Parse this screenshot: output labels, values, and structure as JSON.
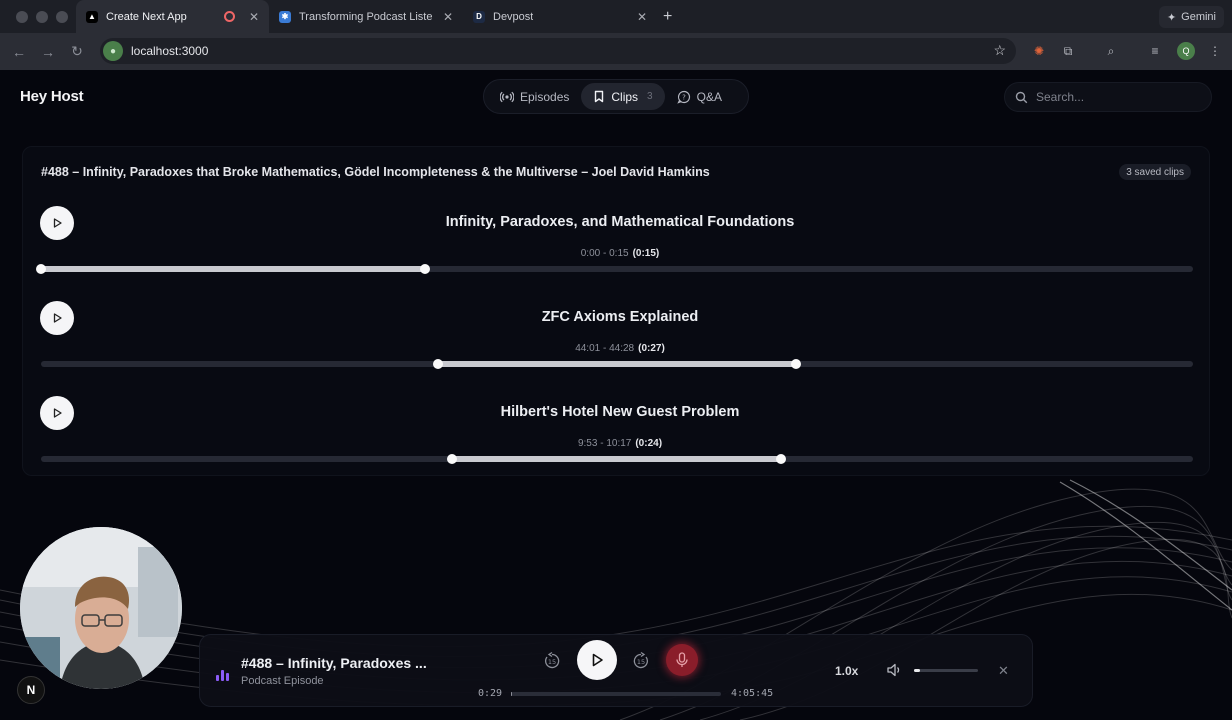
{
  "browser": {
    "tabs": [
      {
        "title": "Create Next App",
        "active": true,
        "recording": true
      },
      {
        "title": "Transforming Podcast Listeni",
        "active": false
      },
      {
        "title": "Devpost",
        "active": false
      }
    ],
    "new_tab_icon": "plus-icon",
    "gemini_label": "Gemini",
    "url": "localhost:3000",
    "profile_initial": "Q"
  },
  "app": {
    "logo": "Hey Host",
    "nav": {
      "episodes_label": "Episodes",
      "clips_label": "Clips",
      "clips_count": "3",
      "qa_label": "Q&A",
      "active": "clips"
    },
    "search": {
      "placeholder": "Search..."
    },
    "episode": {
      "title": "#488 – Infinity, Paradoxes that Broke Mathematics, Gödel Incompleteness & the Multiverse – Joel David Hamkins",
      "saved_badge": "3 saved clips"
    },
    "clips": [
      {
        "title": "Infinity, Paradoxes, and Mathematical Foundations",
        "range": "0:00 - 0:15",
        "duration": "(0:15)",
        "start_frac": 0.0,
        "end_frac": 0.333
      },
      {
        "title": "ZFC Axioms Explained",
        "range": "44:01 - 44:28",
        "duration": "(0:27)",
        "start_frac": 0.345,
        "end_frac": 0.655
      },
      {
        "title": "Hilbert's Hotel New Guest Problem",
        "range": "9:53 - 10:17",
        "duration": "(0:24)",
        "start_frac": 0.357,
        "end_frac": 0.642
      }
    ],
    "webcam_badge": "N"
  },
  "player": {
    "title": "#488 – Infinity, Paradoxes ...",
    "subtitle": "Podcast Episode",
    "current_time": "0:29",
    "duration": "4:05:45",
    "progress_frac": 0.002,
    "speed": "1.0x",
    "volume_frac": 0.1,
    "skip_back_seconds": "15",
    "skip_forward_seconds": "15",
    "accent_color": "#8b5cf6",
    "mic_color": "#8a1d2a"
  }
}
